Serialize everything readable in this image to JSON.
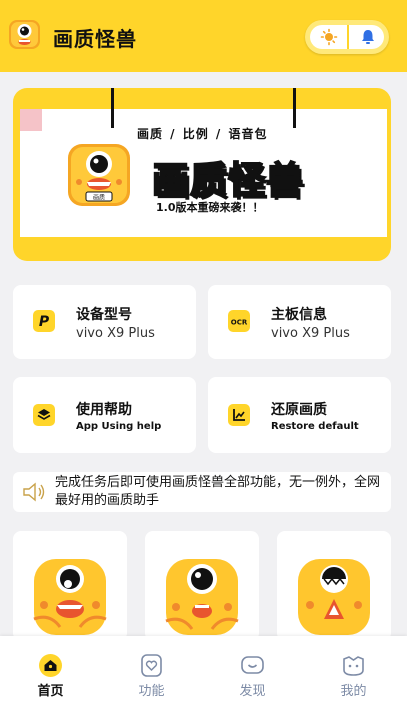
{
  "header": {
    "title": "画质怪兽",
    "logo_icon": "monster-logo-icon",
    "actions": [
      "sun-theme-icon",
      "bell-icon"
    ],
    "accent_color": "#ffd52a"
  },
  "banner": {
    "subtitle": "画质 / 比例 / 语音包",
    "title": "画质怪兽",
    "tagline": "1.0版本重磅来袭！！",
    "icon_caption": "画质"
  },
  "feature_cards": [
    {
      "icon": "p-letter-icon",
      "title": "设备型号",
      "subtitle": "vivo X9 Plus"
    },
    {
      "icon": "ocr-icon",
      "icon_text": "OCR",
      "title": "主板信息",
      "subtitle": "vivo X9 Plus"
    },
    {
      "icon": "layers-icon",
      "title": "使用帮助",
      "subtitle": "App Using help"
    },
    {
      "icon": "chart-icon",
      "title": "还原画质",
      "subtitle": "Restore default"
    }
  ],
  "notice": {
    "icon": "speaker-icon",
    "text": "完成任务后即可使用画质怪兽全部功能，无一例外，全网最好用的画质助手"
  },
  "mascots": [
    "monster-cheerful-icon",
    "monster-grin-icon",
    "monster-spike-icon"
  ],
  "tabs": [
    {
      "label": "首页",
      "icon": "home-icon",
      "active": true
    },
    {
      "label": "功能",
      "icon": "heart-box-icon",
      "active": false
    },
    {
      "label": "发现",
      "icon": "chat-smile-icon",
      "active": false
    },
    {
      "label": "我的",
      "icon": "cat-face-icon",
      "active": false
    }
  ]
}
